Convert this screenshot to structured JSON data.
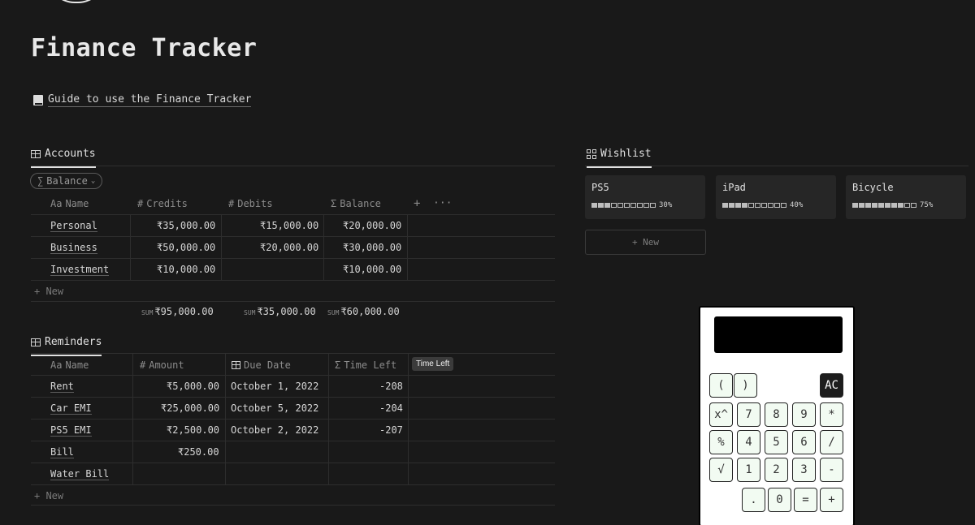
{
  "page": {
    "title": "Finance Tracker",
    "guide_link": "Guide to use the Finance Tracker"
  },
  "accounts": {
    "view_label": "Accounts",
    "filter_label": "Balance",
    "columns": [
      "Name",
      "Credits",
      "Debits",
      "Balance"
    ],
    "column_prefixes": [
      "Aa",
      "#",
      "#",
      "Σ"
    ],
    "rows": [
      {
        "name": "Personal",
        "credits": "₹35,000.00",
        "debits": "₹15,000.00",
        "balance": "₹20,000.00"
      },
      {
        "name": "Business",
        "credits": "₹50,000.00",
        "debits": "₹20,000.00",
        "balance": "₹30,000.00"
      },
      {
        "name": "Investment",
        "credits": "₹10,000.00",
        "debits": "",
        "balance": "₹10,000.00"
      }
    ],
    "new_label": "+ New",
    "sum_label": "SUM",
    "sums": {
      "credits": "₹95,000.00",
      "debits": "₹35,000.00",
      "balance": "₹60,000.00"
    }
  },
  "reminders": {
    "view_label": "Reminders",
    "columns": [
      "Name",
      "Amount",
      "Due Date",
      "Time Left"
    ],
    "column_prefixes": [
      "Aa",
      "#",
      "",
      "Σ"
    ],
    "tooltip": "Time Left",
    "rows": [
      {
        "name": "Rent",
        "amount": "₹5,000.00",
        "due": "October 1, 2022",
        "left": "-208"
      },
      {
        "name": "Car EMI",
        "amount": "₹25,000.00",
        "due": "October 5, 2022",
        "left": "-204"
      },
      {
        "name": "PS5 EMI",
        "amount": "₹2,500.00",
        "due": "October 2, 2022",
        "left": "-207"
      },
      {
        "name": "Bill",
        "amount": "₹250.00",
        "due": "",
        "left": ""
      },
      {
        "name": "Water Bill",
        "amount": "",
        "due": "",
        "left": ""
      }
    ],
    "new_label": "+ New"
  },
  "wishlist": {
    "view_label": "Wishlist",
    "items": [
      {
        "name": "PS5",
        "progress": 0.3,
        "progress_label": "30%"
      },
      {
        "name": "iPad",
        "progress": 0.4,
        "progress_label": "40%"
      },
      {
        "name": "Bicycle",
        "progress": 0.75,
        "progress_label": "75%"
      }
    ],
    "new_label": "+ New"
  },
  "calculator": {
    "display": "",
    "keys": {
      "lparen": "(",
      "rparen": ")",
      "ac": "AC",
      "pow": "x^",
      "k7": "7",
      "k8": "8",
      "k9": "9",
      "mul": "*",
      "pct": "%",
      "k4": "4",
      "k5": "5",
      "k6": "6",
      "div": "/",
      "sqrt": "√",
      "k1": "1",
      "k2": "2",
      "k3": "3",
      "sub": "-",
      "dot": ".",
      "k0": "0",
      "eq": "=",
      "add": "+"
    }
  }
}
